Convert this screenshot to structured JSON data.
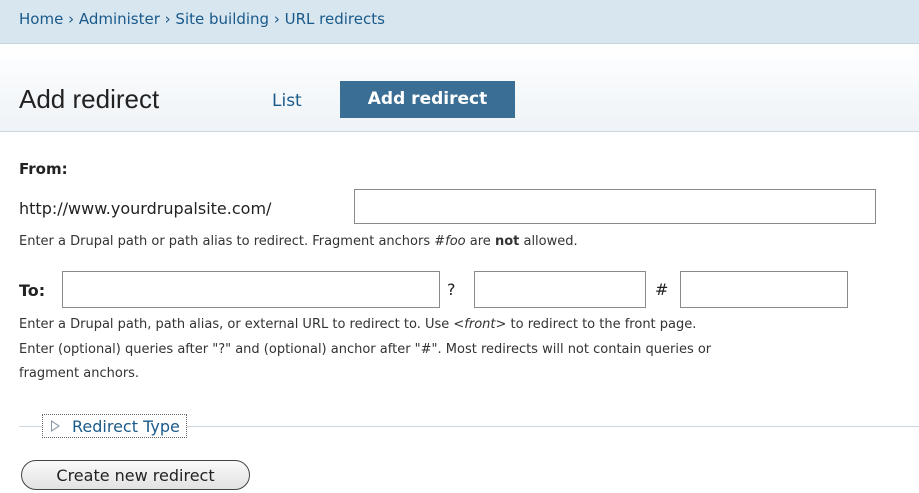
{
  "breadcrumb": "Home › Administer › Site building › URL redirects",
  "page": {
    "title": "Add redirect"
  },
  "tabs": {
    "list": "List",
    "add": "Add redirect"
  },
  "from": {
    "label": "From:",
    "base_url": "http://www.yourdrupalsite.com/",
    "value": "",
    "help_pre": "Enter a Drupal path or path alias to redirect. Fragment anchors ",
    "help_em": "#foo",
    "help_mid": " are ",
    "help_strong": "not",
    "help_post": " allowed."
  },
  "to": {
    "label": "To:",
    "value": "",
    "query_separator": "?",
    "query_value": "",
    "anchor_separator": "#",
    "anchor_value": "",
    "help_line1_pre": "Enter a Drupal path, path alias, or external URL to redirect to. Use ",
    "help_line1_em": "<front>",
    "help_line1_post": " to redirect to the front page.",
    "help_line2": "Enter (optional) queries after \"?\" and (optional) anchor after \"#\". Most redirects will not contain queries or",
    "help_line3": "fragment anchors."
  },
  "redirect_type": {
    "legend": "Redirect Type",
    "collapsed": true
  },
  "submit_label": "Create new redirect"
}
